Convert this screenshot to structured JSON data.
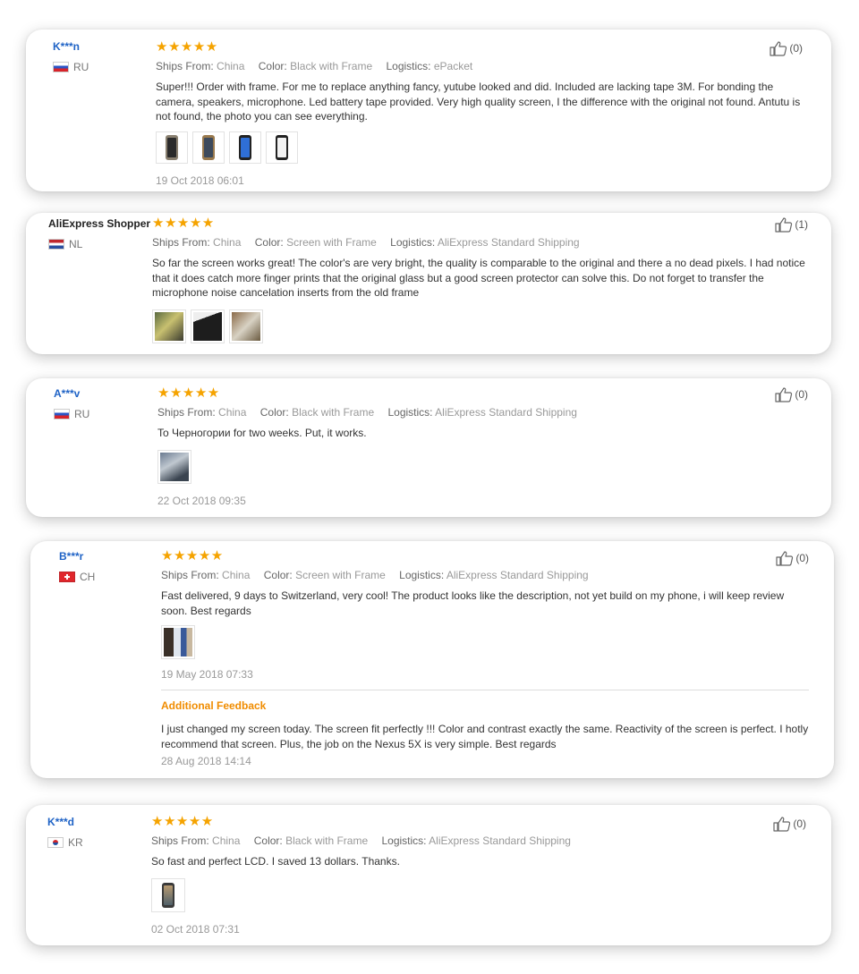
{
  "reviews": [
    {
      "user": "K***n",
      "country": "RU",
      "stars": "★★★★★",
      "ships_label": "Ships From:",
      "ships": "China",
      "color_label": "Color:",
      "color": "Black with Frame",
      "logistics_label": "Logistics:",
      "logistics": "ePacket",
      "text": "Super!!! Order with frame. For me to replace anything fancy, yutube looked and did. Included are lacking tape 3M. For bonding the camera, speakers, microphone. Led battery tape provided. Very high quality screen, I the difference with the original not found. Antutu is not found, the photo you can see everything.",
      "date": "19 Oct 2018 06:01",
      "likes": "(0)"
    },
    {
      "user": "AliExpress Shopper",
      "country": "NL",
      "stars": "★★★★★",
      "ships_label": "Ships From:",
      "ships": "China",
      "color_label": "Color:",
      "color": "Screen with Frame",
      "logistics_label": "Logistics:",
      "logistics": "AliExpress Standard Shipping",
      "text": "So far the screen works great! The color's are very bright, the quality is comparable to the original and there a no dead pixels. I had notice that it does catch more finger prints that the original glass but a good screen protector can solve this. Do not forget to transfer the microphone noise cancelation inserts from the old frame",
      "likes": "(1)"
    },
    {
      "user": "A***v",
      "country": "RU",
      "stars": "★★★★★",
      "ships_label": "Ships From:",
      "ships": "China",
      "color_label": "Color:",
      "color": "Black with Frame",
      "logistics_label": "Logistics:",
      "logistics": "AliExpress Standard Shipping",
      "text": "To Черногории for two weeks. Put, it works.",
      "date": "22 Oct 2018 09:35",
      "likes": "(0)"
    },
    {
      "user": "B***r",
      "country": "CH",
      "stars": "★★★★★",
      "ships_label": "Ships From:",
      "ships": "China",
      "color_label": "Color:",
      "color": "Screen with Frame",
      "logistics_label": "Logistics:",
      "logistics": "AliExpress Standard Shipping",
      "text": "Fast delivered, 9 days to Switzerland, very cool! The product looks like the description, not yet build on my phone, i will keep review soon. Best regards",
      "date": "19 May 2018 07:33",
      "additional_title": "Additional Feedback",
      "additional_text": "I just changed my screen today. The screen fit perfectly !!! Color and contrast exactly the same. Reactivity of the screen is perfect. I hotly recommend that screen. Plus, the job on the Nexus 5X is very simple. Best regards",
      "additional_date": "28 Aug 2018 14:14",
      "likes": "(0)"
    },
    {
      "user": "K***d",
      "country": "KR",
      "stars": "★★★★★",
      "ships_label": "Ships From:",
      "ships": "China",
      "color_label": "Color:",
      "color": "Black with Frame",
      "logistics_label": "Logistics:",
      "logistics": "AliExpress Standard Shipping",
      "text": "So fast and perfect LCD. I saved 13 dollars. Thanks.",
      "date": "02 Oct 2018 07:31",
      "likes": "(0)"
    }
  ],
  "colors": {
    "username": "#1f63c6",
    "stars": "#f5a300",
    "additional": "#f08c00"
  },
  "icons": {
    "like": "thumbs-up-icon"
  }
}
